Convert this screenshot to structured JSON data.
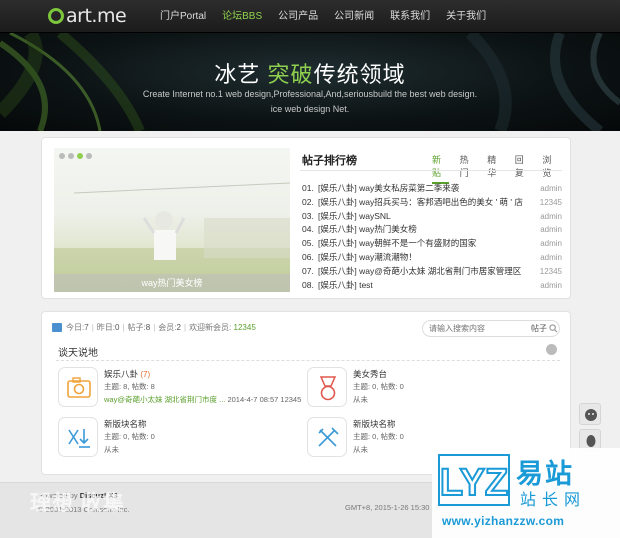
{
  "header": {
    "logo_text": "art.me",
    "nav": [
      "门户Portal",
      "论坛BBS",
      "公司产品",
      "公司新闻",
      "联系我们",
      "关于我们"
    ],
    "active_nav": 1
  },
  "banner": {
    "title_a": "冰艺 ",
    "title_hl": "突破",
    "title_b": "传统领域",
    "sub1": "Create Internet no.1 web design,Professional,And,seriousbuild the best web design.",
    "sub2": "ice web design Net."
  },
  "slider": {
    "caption": "way热门美女榜",
    "dots": 4,
    "active_dot": 2
  },
  "ranking": {
    "title": "帖子排行榜",
    "tabs": [
      "新贴",
      "热门",
      "精华",
      "回复",
      "浏览"
    ],
    "active_tab": 0,
    "items": [
      {
        "num": "01.",
        "text": "[娱乐八卦] way美女私房菜第二季来袭",
        "author": "admin"
      },
      {
        "num": "02.",
        "text": "[娱乐八卦] way招兵买马：客邦酒吧出色的美女 ' 萌 ' 店",
        "author": "12345"
      },
      {
        "num": "03.",
        "text": "[娱乐八卦] waySNL",
        "author": "admin"
      },
      {
        "num": "04.",
        "text": "[娱乐八卦] way热门美女榜",
        "author": "admin"
      },
      {
        "num": "05.",
        "text": "[娱乐八卦] way朝鲜不是一个有盛财的国家",
        "author": "admin"
      },
      {
        "num": "06.",
        "text": "[娱乐八卦] way潮流潮物！",
        "author": "admin"
      },
      {
        "num": "07.",
        "text": "[娱乐八卦] way@奇葩小太妹 湖北省荆门市居家管理区",
        "author": "12345"
      },
      {
        "num": "08.",
        "text": "[娱乐八卦] test",
        "author": "admin"
      }
    ]
  },
  "stats": {
    "today_label": "今日:",
    "today": "7",
    "yesterday_label": "昨日:",
    "yesterday": "0",
    "posts_label": "帖子:",
    "posts": "8",
    "members_label": "会员:",
    "members": "2",
    "newest_label": "欢迎新会员:",
    "newest": "12345"
  },
  "search": {
    "placeholder": "请输入搜索内容",
    "button": "帖子"
  },
  "section": {
    "title": "谈天说地"
  },
  "forums": [
    {
      "name": "娱乐八卦",
      "new_count": "(7)",
      "meta": "主题: 8, 帖数: 8",
      "last_link": "way@奇葩小太妹 湖北省荆门市度 ...",
      "last_time": " 2014-4-7 08:57 12345",
      "icon": "camera-icon"
    },
    {
      "name": "美女秀台",
      "new_count": "",
      "meta": "主题: 0, 帖数: 0",
      "last_link": "",
      "last_time": "从未",
      "icon": "medal-icon"
    },
    {
      "name": "新版块名称",
      "new_count": "",
      "meta": "主题: 0, 帖数: 0",
      "last_link": "",
      "last_time": "从未",
      "icon": "download-icon"
    },
    {
      "name": "新版块名称",
      "new_count": "",
      "meta": "主题: 0, 帖数: 0",
      "last_link": "",
      "last_time": "从未",
      "icon": "tools-icon"
    }
  ],
  "footer": {
    "powered_label": "Powered by",
    "powered_name": "Discuz! X3",
    "copyright": "© 2001-2013 Comsenz Inc.",
    "right": "GMT+8, 2015-1-26 15:30 , P",
    "overlay": "理想 收集"
  },
  "watermark": {
    "logo": "LYZ",
    "cn1": "易站",
    "cn2": "站长网",
    "url": "www.yizhanzzw.com"
  },
  "colors": {
    "accent_green": "#8fd14f",
    "link_green": "#5aa02c",
    "brand_blue": "#1a9ad6"
  }
}
